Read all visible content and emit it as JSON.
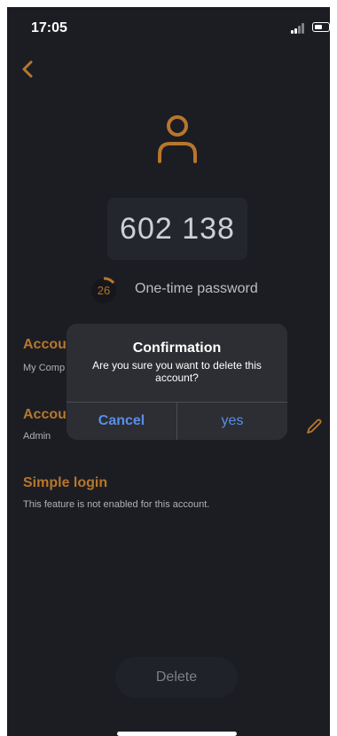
{
  "status": {
    "time": "17:05"
  },
  "otp": {
    "code": "602 138",
    "seconds": "26",
    "label": "One-time password"
  },
  "sections": {
    "company": {
      "title": "Accou",
      "value": "My Comp"
    },
    "role": {
      "title": "Accou",
      "value": "Admin"
    },
    "simple_login": {
      "title": "Simple login",
      "note": "This feature is not enabled for this account."
    }
  },
  "delete": {
    "label": "Delete"
  },
  "dialog": {
    "title": "Confirmation",
    "message": "Are you sure you want to delete this account?",
    "cancel_label": "Cancel",
    "yes_label": "yes"
  },
  "colors": {
    "accent": "#b8762c",
    "background": "#1b1d23",
    "dialog_button": "#5a8ee6"
  }
}
